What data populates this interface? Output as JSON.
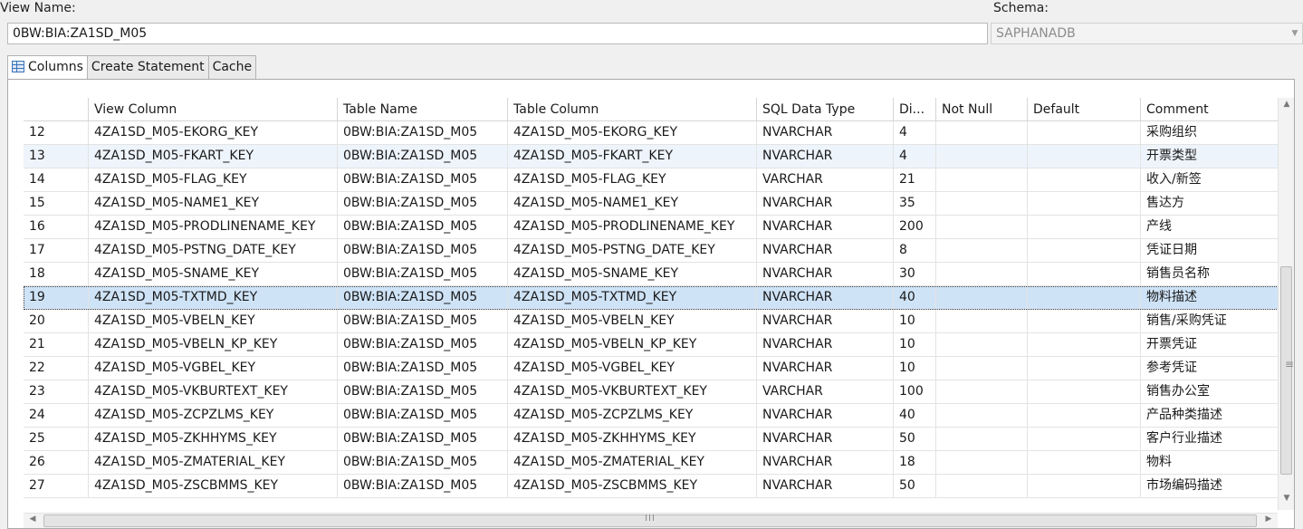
{
  "view": {
    "name_label": "View Name:",
    "name_value": "0BW:BIA:ZA1SD_M05",
    "schema_label": "Schema:",
    "schema_value": "SAPHANADB"
  },
  "tabs": [
    {
      "label": "Columns",
      "active": true,
      "icon": "table-icon"
    },
    {
      "label": "Create Statement",
      "active": false
    },
    {
      "label": "Cache",
      "active": false
    }
  ],
  "table": {
    "headers": [
      "",
      "View Column",
      "Table Name",
      "Table Column",
      "SQL Data Type",
      "Di...",
      "Not Null",
      "Default",
      "Comment"
    ],
    "rows": [
      [
        "12",
        "4ZA1SD_M05-EKORG_KEY",
        "0BW:BIA:ZA1SD_M05",
        "4ZA1SD_M05-EKORG_KEY",
        "NVARCHAR",
        "4",
        "",
        "",
        "采购组织"
      ],
      [
        "13",
        "4ZA1SD_M05-FKART_KEY",
        "0BW:BIA:ZA1SD_M05",
        "4ZA1SD_M05-FKART_KEY",
        "NVARCHAR",
        "4",
        "",
        "",
        "开票类型"
      ],
      [
        "14",
        "4ZA1SD_M05-FLAG_KEY",
        "0BW:BIA:ZA1SD_M05",
        "4ZA1SD_M05-FLAG_KEY",
        "VARCHAR",
        "21",
        "",
        "",
        "收入/新签"
      ],
      [
        "15",
        "4ZA1SD_M05-NAME1_KEY",
        "0BW:BIA:ZA1SD_M05",
        "4ZA1SD_M05-NAME1_KEY",
        "NVARCHAR",
        "35",
        "",
        "",
        "售达方"
      ],
      [
        "16",
        "4ZA1SD_M05-PRODLINENAME_KEY",
        "0BW:BIA:ZA1SD_M05",
        "4ZA1SD_M05-PRODLINENAME_KEY",
        "NVARCHAR",
        "200",
        "",
        "",
        "产线"
      ],
      [
        "17",
        "4ZA1SD_M05-PSTNG_DATE_KEY",
        "0BW:BIA:ZA1SD_M05",
        "4ZA1SD_M05-PSTNG_DATE_KEY",
        "NVARCHAR",
        "8",
        "",
        "",
        "凭证日期"
      ],
      [
        "18",
        "4ZA1SD_M05-SNAME_KEY",
        "0BW:BIA:ZA1SD_M05",
        "4ZA1SD_M05-SNAME_KEY",
        "NVARCHAR",
        "30",
        "",
        "",
        "销售员名称"
      ],
      [
        "19",
        "4ZA1SD_M05-TXTMD_KEY",
        "0BW:BIA:ZA1SD_M05",
        "4ZA1SD_M05-TXTMD_KEY",
        "NVARCHAR",
        "40",
        "",
        "",
        "物料描述"
      ],
      [
        "20",
        "4ZA1SD_M05-VBELN_KEY",
        "0BW:BIA:ZA1SD_M05",
        "4ZA1SD_M05-VBELN_KEY",
        "NVARCHAR",
        "10",
        "",
        "",
        "销售/采购凭证"
      ],
      [
        "21",
        "4ZA1SD_M05-VBELN_KP_KEY",
        "0BW:BIA:ZA1SD_M05",
        "4ZA1SD_M05-VBELN_KP_KEY",
        "NVARCHAR",
        "10",
        "",
        "",
        "开票凭证"
      ],
      [
        "22",
        "4ZA1SD_M05-VGBEL_KEY",
        "0BW:BIA:ZA1SD_M05",
        "4ZA1SD_M05-VGBEL_KEY",
        "NVARCHAR",
        "10",
        "",
        "",
        "参考凭证"
      ],
      [
        "23",
        "4ZA1SD_M05-VKBURTEXT_KEY",
        "0BW:BIA:ZA1SD_M05",
        "4ZA1SD_M05-VKBURTEXT_KEY",
        "VARCHAR",
        "100",
        "",
        "",
        "销售办公室"
      ],
      [
        "24",
        "4ZA1SD_M05-ZCPZLMS_KEY",
        "0BW:BIA:ZA1SD_M05",
        "4ZA1SD_M05-ZCPZLMS_KEY",
        "NVARCHAR",
        "40",
        "",
        "",
        "产品种类描述"
      ],
      [
        "25",
        "4ZA1SD_M05-ZKHHYMS_KEY",
        "0BW:BIA:ZA1SD_M05",
        "4ZA1SD_M05-ZKHHYMS_KEY",
        "NVARCHAR",
        "50",
        "",
        "",
        "客户行业描述"
      ],
      [
        "26",
        "4ZA1SD_M05-ZMATERIAL_KEY",
        "0BW:BIA:ZA1SD_M05",
        "4ZA1SD_M05-ZMATERIAL_KEY",
        "NVARCHAR",
        "18",
        "",
        "",
        "物料"
      ],
      [
        "27",
        "4ZA1SD_M05-ZSCBMMS_KEY",
        "0BW:BIA:ZA1SD_M05",
        "4ZA1SD_M05-ZSCBMMS_KEY",
        "NVARCHAR",
        "50",
        "",
        "",
        "市场编码描述"
      ]
    ],
    "selected_row": 7,
    "alternate_row": 1
  },
  "scrollbars": {
    "vertical_grip": "≡",
    "horizontal_grip": "III",
    "up_arrow": "▲",
    "down_arrow": "▼",
    "left_arrow": "◀",
    "right_arrow": "▶"
  },
  "colors": {
    "selection": "#cfe3f7",
    "alternate": "#eef4fb"
  }
}
